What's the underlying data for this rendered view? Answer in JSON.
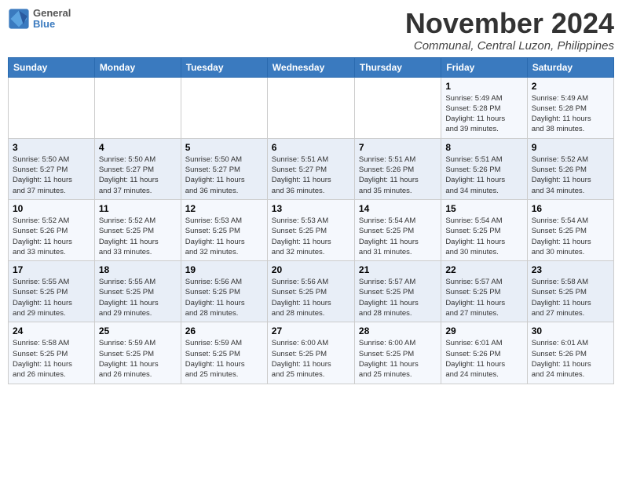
{
  "header": {
    "logo_line1": "General",
    "logo_line2": "Blue",
    "month": "November 2024",
    "location": "Communal, Central Luzon, Philippines"
  },
  "days_of_week": [
    "Sunday",
    "Monday",
    "Tuesday",
    "Wednesday",
    "Thursday",
    "Friday",
    "Saturday"
  ],
  "weeks": [
    [
      {
        "day": "",
        "info": ""
      },
      {
        "day": "",
        "info": ""
      },
      {
        "day": "",
        "info": ""
      },
      {
        "day": "",
        "info": ""
      },
      {
        "day": "",
        "info": ""
      },
      {
        "day": "1",
        "info": "Sunrise: 5:49 AM\nSunset: 5:28 PM\nDaylight: 11 hours\nand 39 minutes."
      },
      {
        "day": "2",
        "info": "Sunrise: 5:49 AM\nSunset: 5:28 PM\nDaylight: 11 hours\nand 38 minutes."
      }
    ],
    [
      {
        "day": "3",
        "info": "Sunrise: 5:50 AM\nSunset: 5:27 PM\nDaylight: 11 hours\nand 37 minutes."
      },
      {
        "day": "4",
        "info": "Sunrise: 5:50 AM\nSunset: 5:27 PM\nDaylight: 11 hours\nand 37 minutes."
      },
      {
        "day": "5",
        "info": "Sunrise: 5:50 AM\nSunset: 5:27 PM\nDaylight: 11 hours\nand 36 minutes."
      },
      {
        "day": "6",
        "info": "Sunrise: 5:51 AM\nSunset: 5:27 PM\nDaylight: 11 hours\nand 36 minutes."
      },
      {
        "day": "7",
        "info": "Sunrise: 5:51 AM\nSunset: 5:26 PM\nDaylight: 11 hours\nand 35 minutes."
      },
      {
        "day": "8",
        "info": "Sunrise: 5:51 AM\nSunset: 5:26 PM\nDaylight: 11 hours\nand 34 minutes."
      },
      {
        "day": "9",
        "info": "Sunrise: 5:52 AM\nSunset: 5:26 PM\nDaylight: 11 hours\nand 34 minutes."
      }
    ],
    [
      {
        "day": "10",
        "info": "Sunrise: 5:52 AM\nSunset: 5:26 PM\nDaylight: 11 hours\nand 33 minutes."
      },
      {
        "day": "11",
        "info": "Sunrise: 5:52 AM\nSunset: 5:25 PM\nDaylight: 11 hours\nand 33 minutes."
      },
      {
        "day": "12",
        "info": "Sunrise: 5:53 AM\nSunset: 5:25 PM\nDaylight: 11 hours\nand 32 minutes."
      },
      {
        "day": "13",
        "info": "Sunrise: 5:53 AM\nSunset: 5:25 PM\nDaylight: 11 hours\nand 32 minutes."
      },
      {
        "day": "14",
        "info": "Sunrise: 5:54 AM\nSunset: 5:25 PM\nDaylight: 11 hours\nand 31 minutes."
      },
      {
        "day": "15",
        "info": "Sunrise: 5:54 AM\nSunset: 5:25 PM\nDaylight: 11 hours\nand 30 minutes."
      },
      {
        "day": "16",
        "info": "Sunrise: 5:54 AM\nSunset: 5:25 PM\nDaylight: 11 hours\nand 30 minutes."
      }
    ],
    [
      {
        "day": "17",
        "info": "Sunrise: 5:55 AM\nSunset: 5:25 PM\nDaylight: 11 hours\nand 29 minutes."
      },
      {
        "day": "18",
        "info": "Sunrise: 5:55 AM\nSunset: 5:25 PM\nDaylight: 11 hours\nand 29 minutes."
      },
      {
        "day": "19",
        "info": "Sunrise: 5:56 AM\nSunset: 5:25 PM\nDaylight: 11 hours\nand 28 minutes."
      },
      {
        "day": "20",
        "info": "Sunrise: 5:56 AM\nSunset: 5:25 PM\nDaylight: 11 hours\nand 28 minutes."
      },
      {
        "day": "21",
        "info": "Sunrise: 5:57 AM\nSunset: 5:25 PM\nDaylight: 11 hours\nand 28 minutes."
      },
      {
        "day": "22",
        "info": "Sunrise: 5:57 AM\nSunset: 5:25 PM\nDaylight: 11 hours\nand 27 minutes."
      },
      {
        "day": "23",
        "info": "Sunrise: 5:58 AM\nSunset: 5:25 PM\nDaylight: 11 hours\nand 27 minutes."
      }
    ],
    [
      {
        "day": "24",
        "info": "Sunrise: 5:58 AM\nSunset: 5:25 PM\nDaylight: 11 hours\nand 26 minutes."
      },
      {
        "day": "25",
        "info": "Sunrise: 5:59 AM\nSunset: 5:25 PM\nDaylight: 11 hours\nand 26 minutes."
      },
      {
        "day": "26",
        "info": "Sunrise: 5:59 AM\nSunset: 5:25 PM\nDaylight: 11 hours\nand 25 minutes."
      },
      {
        "day": "27",
        "info": "Sunrise: 6:00 AM\nSunset: 5:25 PM\nDaylight: 11 hours\nand 25 minutes."
      },
      {
        "day": "28",
        "info": "Sunrise: 6:00 AM\nSunset: 5:25 PM\nDaylight: 11 hours\nand 25 minutes."
      },
      {
        "day": "29",
        "info": "Sunrise: 6:01 AM\nSunset: 5:26 PM\nDaylight: 11 hours\nand 24 minutes."
      },
      {
        "day": "30",
        "info": "Sunrise: 6:01 AM\nSunset: 5:26 PM\nDaylight: 11 hours\nand 24 minutes."
      }
    ]
  ]
}
